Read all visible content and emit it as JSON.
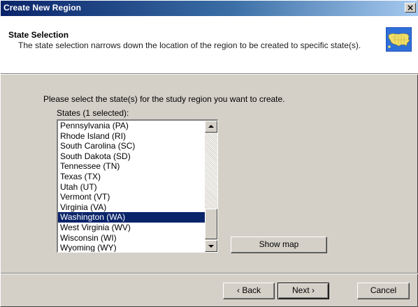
{
  "window": {
    "title": "Create New Region",
    "close_label": "×"
  },
  "header": {
    "title": "State Selection",
    "description": "The state selection narrows down the location of the region to be created to specific state(s).",
    "icon": "us-map-icon"
  },
  "main": {
    "prompt": "Please select the state(s) for the study region you want to create.",
    "list_label": "States (1 selected):",
    "states": [
      "Pennsylvania (PA)",
      "Rhode Island (RI)",
      "South Carolina (SC)",
      "South Dakota (SD)",
      "Tennessee (TN)",
      "Texas (TX)",
      "Utah (UT)",
      "Vermont (VT)",
      "Virginia (VA)",
      "Washington (WA)",
      "West Virginia (WV)",
      "Wisconsin (WI)",
      "Wyoming (WY)"
    ],
    "selected_index": 9,
    "show_map_label": "Show map"
  },
  "footer": {
    "back_label": "‹ Back",
    "next_label": "Next ›",
    "cancel_label": "Cancel"
  },
  "colors": {
    "selection": "#0a246a",
    "face": "#d4d0c8",
    "title_gradient_start": "#0a246a",
    "title_gradient_end": "#a6caf0"
  }
}
